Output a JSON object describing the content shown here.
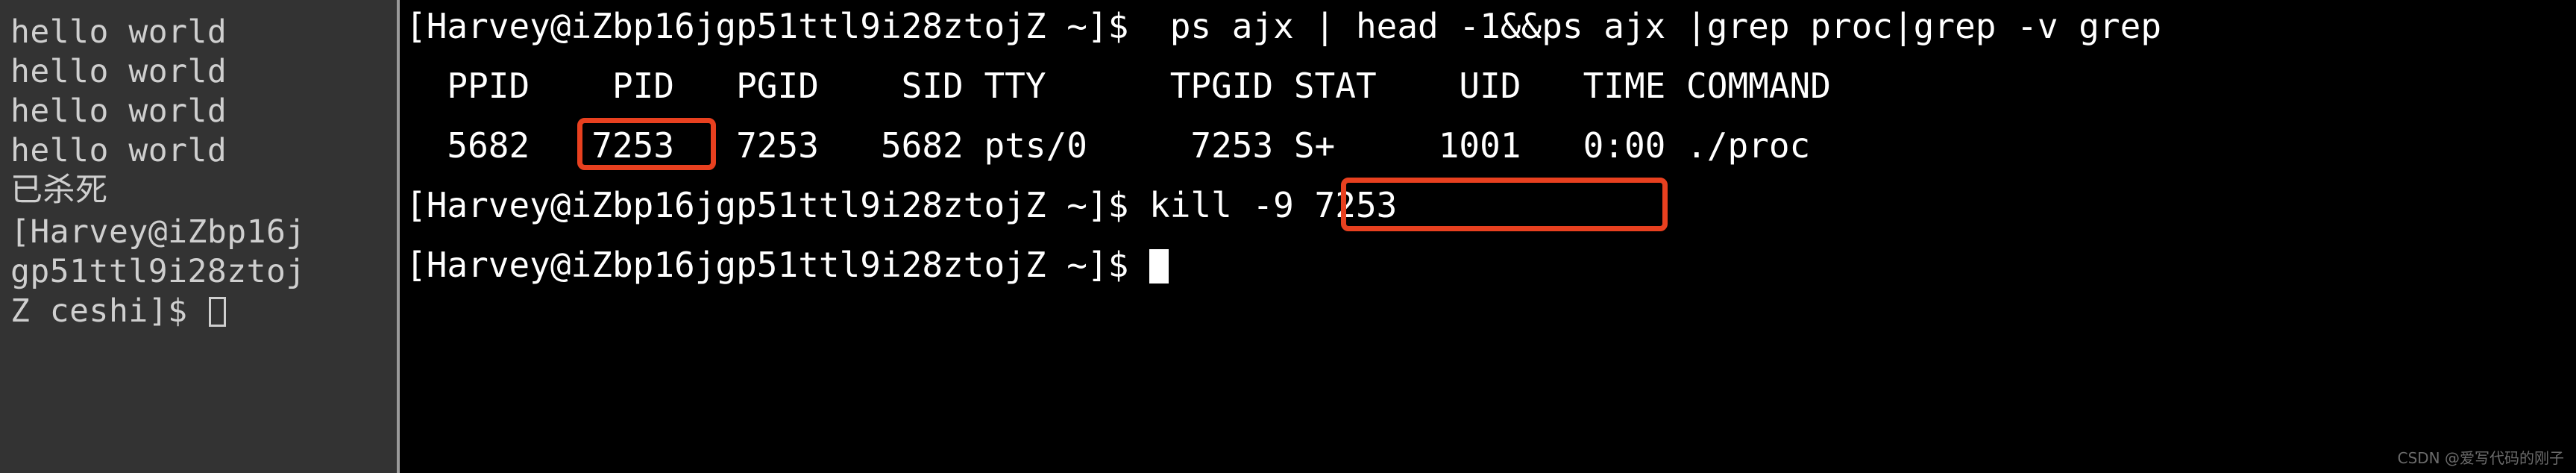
{
  "left_terminal": {
    "background_color": "#333333",
    "text_color": "#cfcfcf",
    "lines": [
      {
        "text": "hello world"
      },
      {
        "text": "hello world"
      },
      {
        "text": "hello world"
      },
      {
        "text": "hello world"
      },
      {
        "text": "已杀死"
      },
      {
        "text": "[Harvey@iZbp16j"
      },
      {
        "text": "gp51ttl9i28ztoj"
      },
      {
        "text": "Z ceshi]$ "
      }
    ]
  },
  "right_terminal": {
    "background_color": "#000000",
    "text_color": "#ffffff",
    "prompt": "[Harvey@iZbp16jgp51ttl9i28ztojZ ~]$",
    "lines": [
      {
        "text": "[Harvey@iZbp16jgp51ttl9i28ztojZ ~]$  ps ajx | head -1&&ps ajx |grep proc|grep -v grep"
      },
      {
        "text": "  PPID    PID   PGID    SID TTY      TPGID STAT    UID   TIME COMMAND"
      },
      {
        "text": "  5682   7253   7253   5682 pts/0     7253 S+     1001   0:00 ./proc"
      },
      {
        "text": "[Harvey@iZbp16jgp51ttl9i28ztojZ ~]$ kill -9 7253"
      },
      {
        "text": "[Harvey@iZbp16jgp51ttl9i28ztojZ ~]$ "
      }
    ],
    "ps_table": {
      "headers": [
        "PPID",
        "PID",
        "PGID",
        "SID",
        "TTY",
        "TPGID",
        "STAT",
        "UID",
        "TIME",
        "COMMAND"
      ],
      "rows": [
        [
          "5682",
          "7253",
          "7253",
          "5682",
          "pts/0",
          "7253",
          "S+",
          "1001",
          "0:00",
          "./proc"
        ]
      ]
    },
    "commands": {
      "ps_command": "ps ajx | head -1&&ps ajx |grep proc|grep -v grep",
      "kill_command": "kill -9 7253"
    }
  },
  "annotations": {
    "color": "#e8401f",
    "boxes": [
      {
        "id": "pid-highlight",
        "target_text": "7253"
      },
      {
        "id": "kill-command-highlight",
        "target_text": "kill -9 7253"
      }
    ]
  },
  "watermark": {
    "text": "CSDN @爱写代码的刚子"
  }
}
